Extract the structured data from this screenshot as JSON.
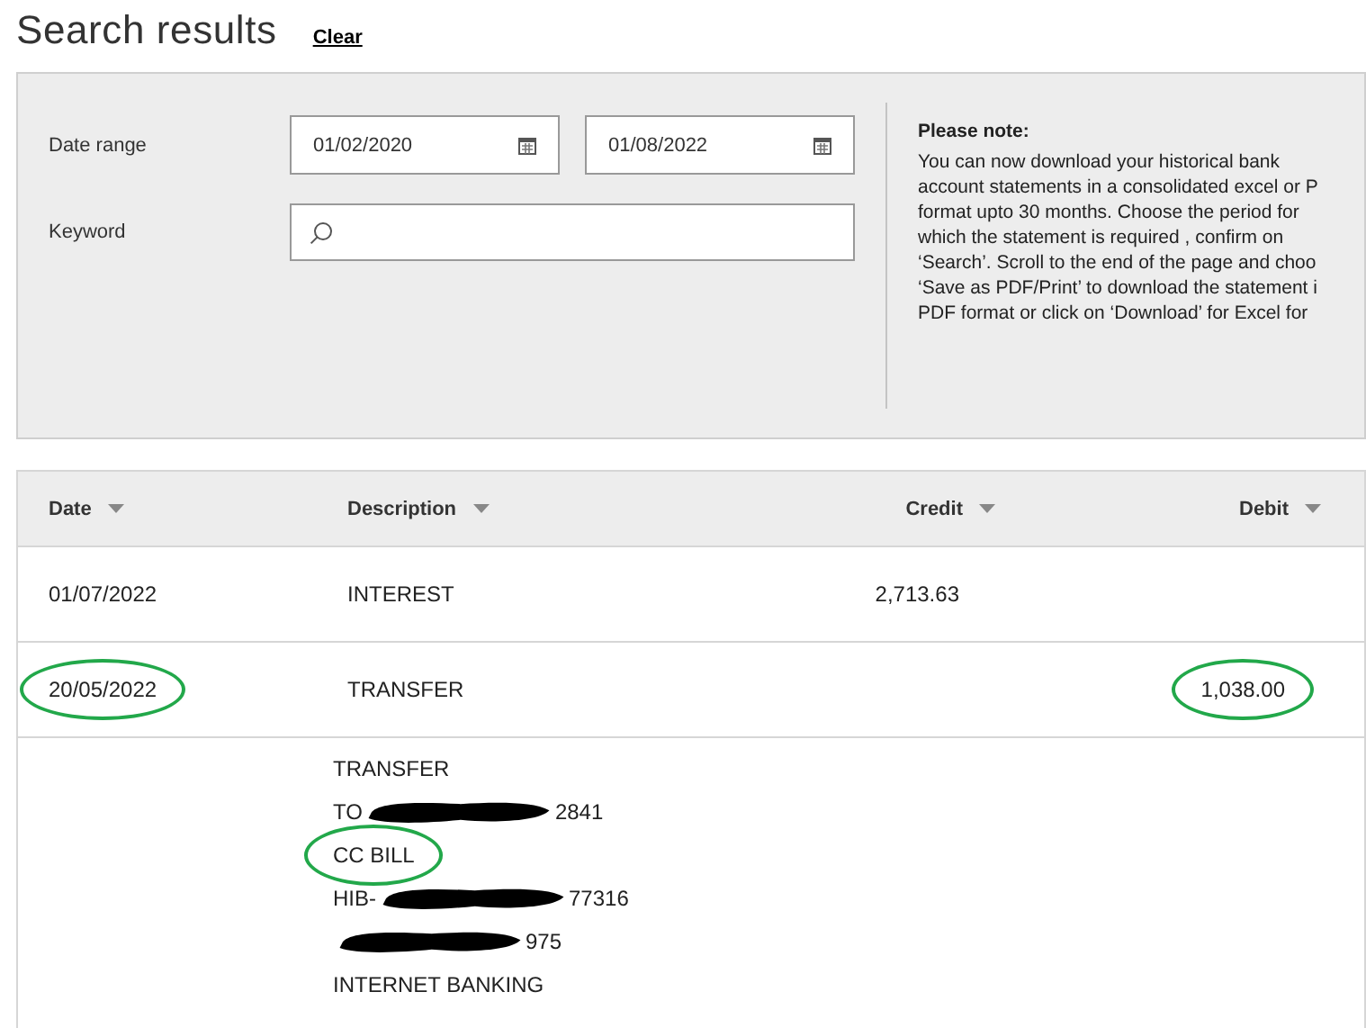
{
  "page": {
    "title": "Search results",
    "clear_link": "Clear"
  },
  "filters": {
    "date_range": {
      "label": "Date range",
      "from": "01/02/2020",
      "to": "01/08/2022"
    },
    "keyword": {
      "label": "Keyword"
    },
    "note": {
      "heading": "Please note:",
      "lines": [
        "You can now download your historical bank",
        "account statements in a consolidated excel or P",
        "format upto 30 months. Choose the period for",
        "which the statement is required , confirm on",
        "‘Search’. Scroll to the end of the page and choo",
        "‘Save as PDF/Print’ to download the statement i",
        "PDF format or click on ‘Download’ for Excel for"
      ]
    }
  },
  "table": {
    "columns": [
      "Date",
      "Description",
      "Credit",
      "Debit"
    ],
    "rows": [
      {
        "cells": [
          {
            "text": "01/07/2022",
            "circled": false
          },
          {
            "text": "INTEREST",
            "circled": false
          },
          {
            "text": "2,713.63",
            "circled": false
          },
          null
        ]
      },
      {
        "cells": [
          {
            "text": "20/05/2022",
            "circled": true
          },
          {
            "text": "TRANSFER",
            "circled": false
          },
          null,
          {
            "text": "1,038.00",
            "circled": true
          }
        ]
      }
    ],
    "detail_lines": [
      {
        "before": "TRANSFER",
        "redacted": false,
        "circled": false
      },
      {
        "before": "TO",
        "redacted": true,
        "after": "2841",
        "circled": false
      },
      {
        "before": "CC BILL",
        "redacted": false,
        "circled": true
      },
      {
        "before": "HIB-",
        "redacted": true,
        "after": "77316",
        "circled": false
      },
      {
        "redacted": true,
        "after": "975",
        "circled": false
      },
      {
        "before": "INTERNET BANKING",
        "redacted": false,
        "circled": false
      }
    ]
  }
}
